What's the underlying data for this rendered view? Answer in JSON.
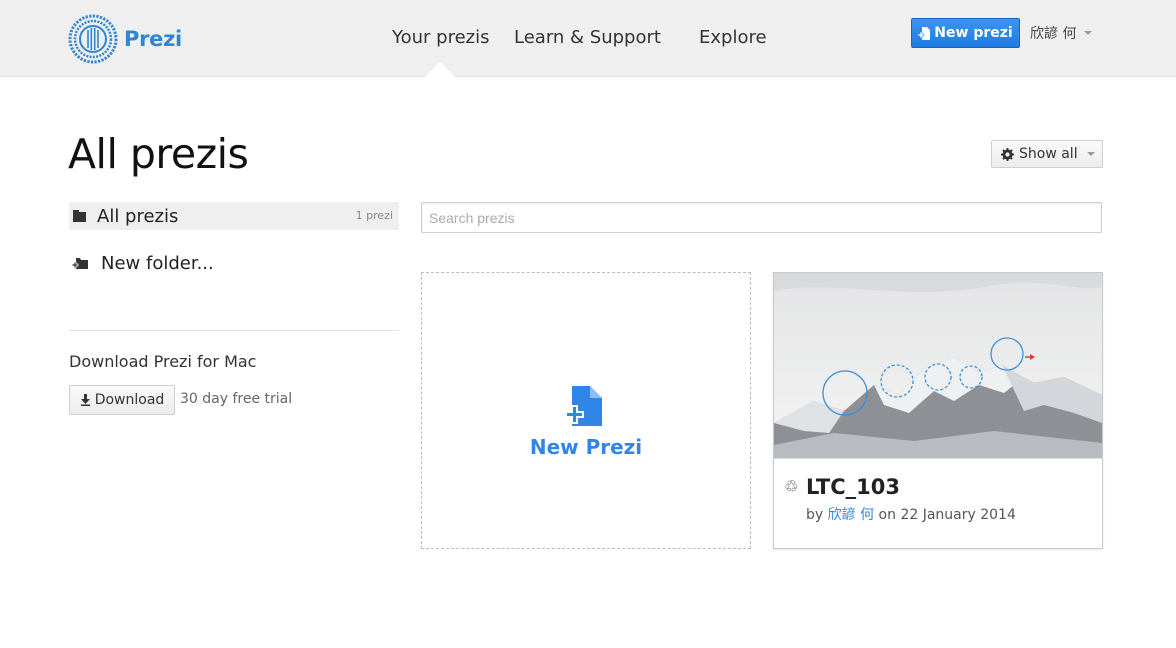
{
  "header": {
    "logo_text": "Prezi",
    "nav": [
      "Your prezis",
      "Learn & Support",
      "Explore"
    ],
    "new_prezi_label": "New prezi",
    "user_name": "欣諺 何"
  },
  "main": {
    "title": "All prezis",
    "show_all_label": "Show all"
  },
  "sidebar": {
    "all_prezis_label": "All prezis",
    "all_prezis_count": "1 prezi",
    "new_folder_label": "New folder...",
    "download_title": "Download Prezi for Mac",
    "download_button_label": "Download",
    "download_note": "30 day free trial"
  },
  "search": {
    "placeholder": "Search prezis",
    "value": ""
  },
  "cards": {
    "new_prezi_label": "New Prezi",
    "prezi": {
      "title": "LTC_103",
      "by_label": "by",
      "author": "欣諺 何",
      "on_label": "on",
      "date": "22 January 2014"
    }
  },
  "colors": {
    "accent": "#2f86e6",
    "header_bg": "#efefef"
  }
}
